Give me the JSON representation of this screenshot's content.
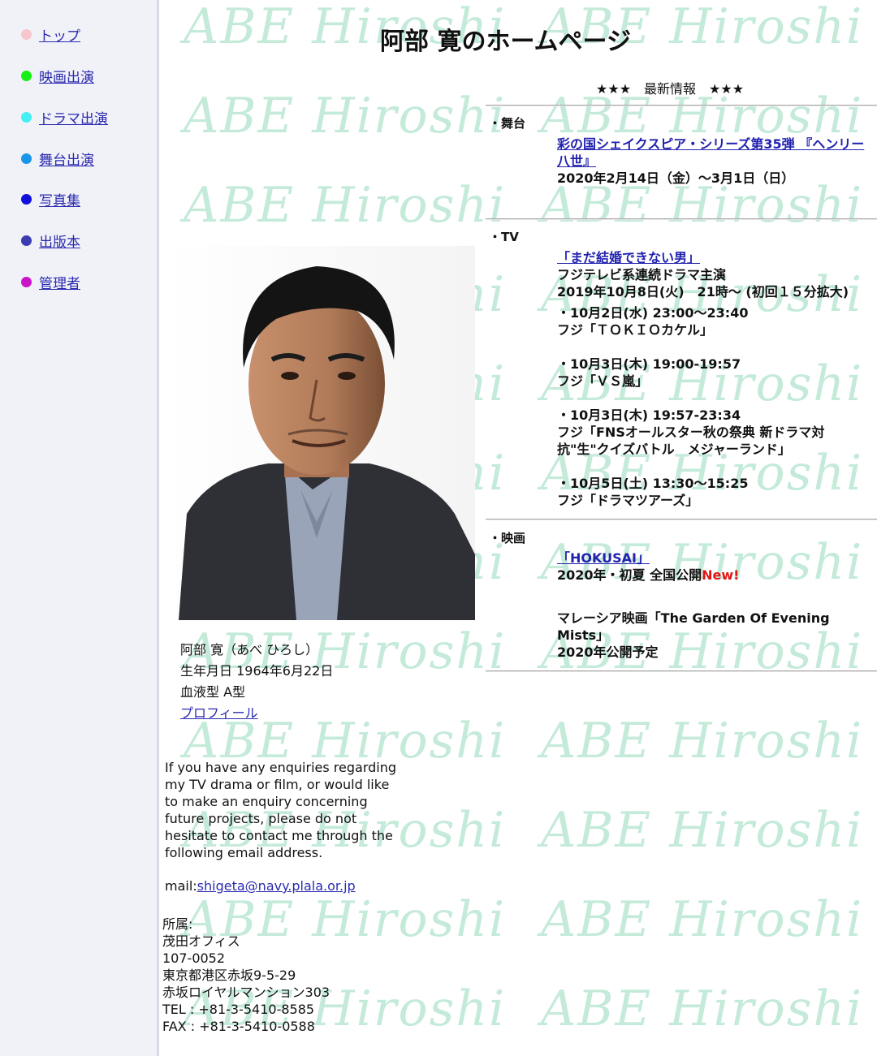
{
  "watermark_text": "ABE Hiroshi",
  "nav": [
    {
      "label": "トップ",
      "color": "#f6c6cc"
    },
    {
      "label": "映画出演",
      "color": "#16f016"
    },
    {
      "label": "ドラマ出演",
      "color": "#44f0f4"
    },
    {
      "label": "舞台出演",
      "color": "#1a96e6"
    },
    {
      "label": "写真集",
      "color": "#1010dd"
    },
    {
      "label": "出版本",
      "color": "#3c3cb0"
    },
    {
      "label": "管理者",
      "color": "#c815c8"
    }
  ],
  "header": {
    "title": "阿部 寛のホームページ"
  },
  "news": {
    "heading": "★★★　最新情報　★★★",
    "stage": {
      "label": "・舞台",
      "link": "彩の国シェイクスピア・シリーズ第35弾 『ヘンリー八世』",
      "date": "2020年2月14日（金）～3月1日（日）"
    },
    "tv": {
      "label": "・TV",
      "link": "「まだ結婚できない男」",
      "desc": "フジテレビ系連続ドラマ主演",
      "date": "2019年10月8日(火)　21時～ (初回１５分拡大)",
      "items": [
        {
          "time": "・10月2日(水) 23:00～23:40",
          "title": "フジ「ＴＯＫＩＯカケル」"
        },
        {
          "time": "・10月3日(木) 19:00-19:57",
          "title": "フジ「ＶＳ嵐」"
        },
        {
          "time": "・10月3日(木) 19:57-23:34",
          "title": "フジ「FNSオールスター秋の祭典 新ドラマ対抗\"生\"クイズバトル　メジャーランド」"
        },
        {
          "time": "・10月5日(土) 13:30～15:25",
          "title": "フジ「ドラマツアーズ」"
        }
      ]
    },
    "movie": {
      "label": "・映画",
      "link": "「HOKUSAI」",
      "date": "2020年・初夏 全国公開",
      "new_badge": "New!",
      "title2": "マレーシア映画「The Garden Of Evening Mists」",
      "date2": "2020年公開予定"
    }
  },
  "profile": {
    "name": "阿部 寛（あべ ひろし）",
    "birthday": "生年月日 1964年6月22日",
    "blood": "血液型 A型",
    "link": "プロフィール"
  },
  "enquiry": "If you have any enquiries regarding my TV drama or film, or would like to make an enquiry concerning future projects, please do not hesitate to contact me through the following email address.",
  "mail": {
    "prefix": "mail:",
    "address": "shigeta@navy.plala.or.jp"
  },
  "office": {
    "label": "所属:",
    "name": "茂田オフィス",
    "zip": "107-0052",
    "address1": "東京都港区赤坂9-5-29",
    "address2": "赤坂ロイヤルマンション303",
    "tel": "TEL : +81-3-5410-8585",
    "fax": "FAX : +81-3-5410-0588"
  }
}
